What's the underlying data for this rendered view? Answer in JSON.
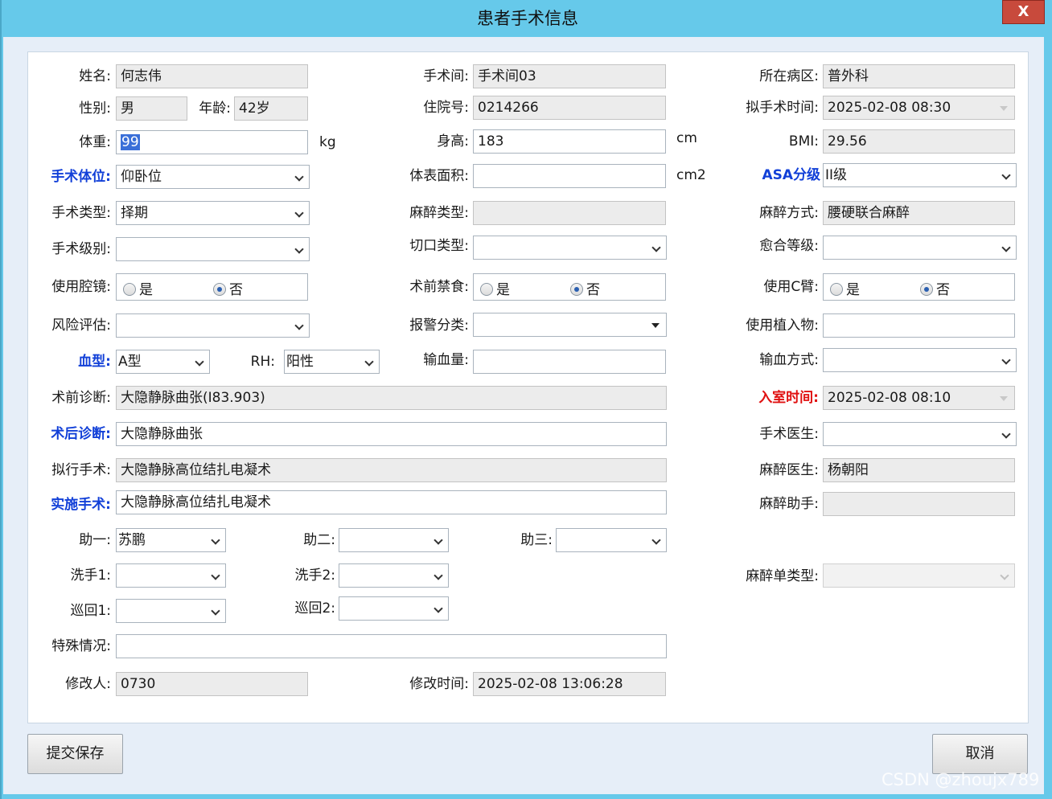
{
  "window": {
    "title": "患者手术信息",
    "close_label": "X"
  },
  "form": {
    "name": {
      "label": "姓名:",
      "value": "何志伟"
    },
    "gender": {
      "label": "性别:",
      "value": "男"
    },
    "age": {
      "label": "年龄:",
      "value": "42岁"
    },
    "weight": {
      "label": "体重:",
      "value": "99",
      "unit": "kg"
    },
    "surgery_pos": {
      "label": "手术体位:",
      "value": "仰卧位"
    },
    "surgery_type": {
      "label": "手术类型:",
      "value": "择期"
    },
    "surgery_level": {
      "label": "手术级别:",
      "value": ""
    },
    "endoscope": {
      "label": "使用腔镜:",
      "yes": "是",
      "no": "否",
      "selected": "否"
    },
    "risk": {
      "label": "风险评估:",
      "value": ""
    },
    "blood_type": {
      "label": "血型:",
      "value": "A型"
    },
    "rh": {
      "label": "RH:",
      "value": "阳性"
    },
    "pre_diag": {
      "label": "术前诊断:",
      "value": "大隐静脉曲张(I83.903)"
    },
    "post_diag": {
      "label": "术后诊断:",
      "value": "大隐静脉曲张"
    },
    "planned_op": {
      "label": "拟行手术:",
      "value": "大隐静脉高位结扎电凝术"
    },
    "actual_op": {
      "label": "实施手术:",
      "value": "大隐静脉高位结扎电凝术"
    },
    "assist1": {
      "label": "助一:",
      "value": "苏鹏"
    },
    "assist2": {
      "label": "助二:",
      "value": ""
    },
    "assist3": {
      "label": "助三:",
      "value": ""
    },
    "scrub1": {
      "label": "洗手1:",
      "value": ""
    },
    "scrub2": {
      "label": "洗手2:",
      "value": ""
    },
    "circ1": {
      "label": "巡回1:",
      "value": ""
    },
    "circ2": {
      "label": "巡回2:",
      "value": ""
    },
    "special": {
      "label": "特殊情况:",
      "value": ""
    },
    "modifier": {
      "label": "修改人:",
      "value": "0730"
    },
    "or_room": {
      "label": "手术间:",
      "value": "手术间03"
    },
    "inpatient_no": {
      "label": "住院号:",
      "value": "0214266"
    },
    "height": {
      "label": "身高:",
      "value": "183",
      "unit": "cm"
    },
    "bsa": {
      "label": "体表面积:",
      "value": "",
      "unit": "cm2"
    },
    "anes_type": {
      "label": "麻醉类型:",
      "value": ""
    },
    "incision": {
      "label": "切口类型:",
      "value": ""
    },
    "fasting": {
      "label": "术前禁食:",
      "yes": "是",
      "no": "否",
      "selected": "否"
    },
    "alarm": {
      "label": "报警分类:",
      "value": ""
    },
    "transfusion_vol": {
      "label": "输血量:",
      "value": ""
    },
    "modify_time": {
      "label": "修改时间:",
      "value": "2025-02-08 13:06:28"
    },
    "ward": {
      "label": "所在病区:",
      "value": "普外科"
    },
    "planned_time": {
      "label": "拟手术时间:",
      "value": "2025-02-08 08:30"
    },
    "bmi": {
      "label": "BMI:",
      "value": "29.56"
    },
    "asa": {
      "label": "ASA分级",
      "value": "II级"
    },
    "anes_method": {
      "label": "麻醉方式:",
      "value": "腰硬联合麻醉"
    },
    "healing": {
      "label": "愈合等级:",
      "value": ""
    },
    "c_arm": {
      "label": "使用C臂:",
      "yes": "是",
      "no": "否",
      "selected": "否"
    },
    "implant": {
      "label": "使用植入物:",
      "value": ""
    },
    "transfusion_method": {
      "label": "输血方式:",
      "value": ""
    },
    "entry_time": {
      "label": "入室时间:",
      "value": "2025-02-08 08:10"
    },
    "surgeon": {
      "label": "手术医生:",
      "value": ""
    },
    "anesthetist": {
      "label": "麻醉医生:",
      "value": "杨朝阳"
    },
    "anes_assist": {
      "label": "麻醉助手:",
      "value": ""
    },
    "anes_form_type": {
      "label": "麻醉单类型:",
      "value": ""
    }
  },
  "buttons": {
    "submit": "提交保存",
    "cancel": "取消"
  },
  "watermark": "CSDN @zhoujx789",
  "colors": {
    "titlebar": "#66c9ea",
    "required_label": "#1240d8",
    "alert_label": "#e01010",
    "close": "#c84a3c"
  }
}
